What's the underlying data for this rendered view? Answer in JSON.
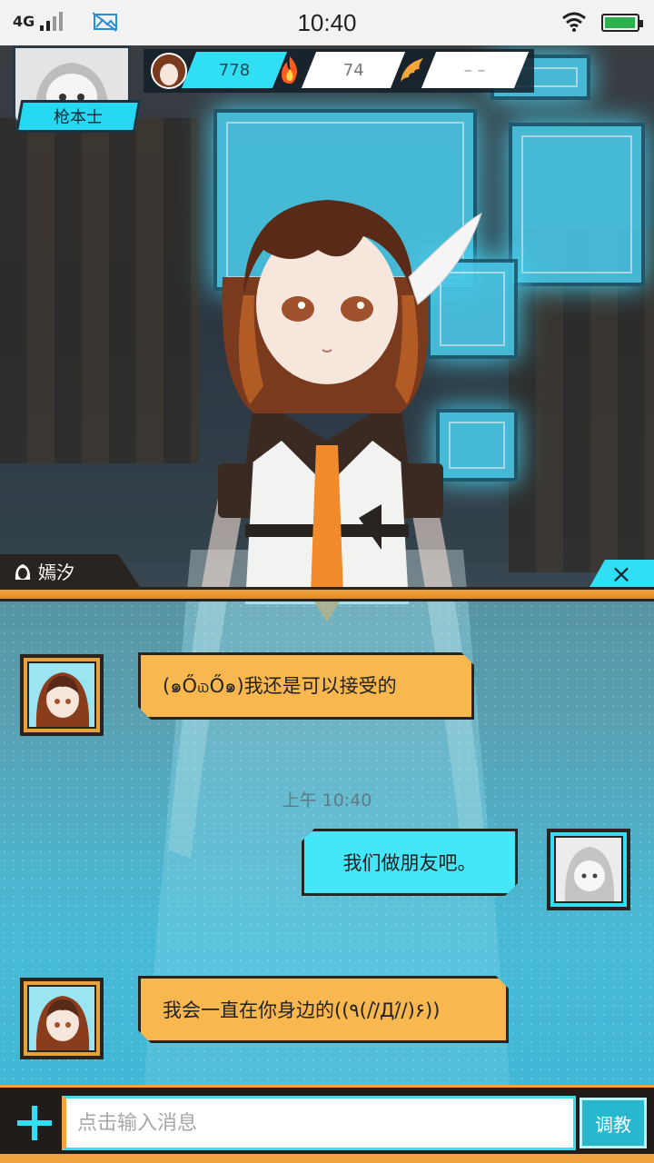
{
  "status_bar": {
    "network": "4G",
    "time": "10:40"
  },
  "hud": {
    "player_name": "枪本士",
    "stats": [
      {
        "icon": "heart-gem-icon",
        "value": "778"
      },
      {
        "icon": "flame-icon",
        "value": "74"
      },
      {
        "icon": "wing-icon",
        "value": "– –"
      }
    ]
  },
  "chat": {
    "character_name": "嫣汐",
    "close_label": "×",
    "timestamp": "上午 10:40",
    "messages": [
      {
        "from": "her",
        "text": "(๑Ő௰Ő๑)我还是可以接受的"
      },
      {
        "from": "me",
        "text": "我们做朋友吧。"
      },
      {
        "from": "her",
        "text": "我会一直在你身边的((٩(//̀Д/́/)۶))"
      }
    ]
  },
  "input": {
    "placeholder": "点击输入消息",
    "send_label": "调教"
  },
  "colors": {
    "accent_cyan": "#31dff5",
    "accent_orange": "#f0a340",
    "dark": "#2a2420"
  }
}
